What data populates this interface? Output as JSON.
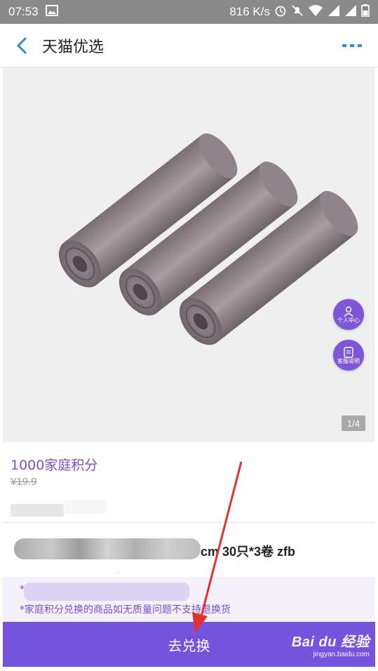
{
  "status_bar": {
    "time": "07:53",
    "net_speed": "816 K/s",
    "icons": [
      "image-icon",
      "alarm-icon",
      "mute-icon",
      "wifi-icon",
      "signal-icon",
      "battery-icon"
    ]
  },
  "nav": {
    "title": "天猫优选",
    "back_icon": "chevron-left-icon",
    "more_icon": "more-icon",
    "accent": "#2a8fd6"
  },
  "floating": {
    "personal_label": "个人中心",
    "service_label": "客服说明",
    "color": "#7d57d6"
  },
  "gallery": {
    "indicator": "1/4"
  },
  "product": {
    "points": "1000家庭积分",
    "original_price": "¥19.9",
    "title_visible_suffix": "cm 30只*3卷 zfb"
  },
  "notice": {
    "line1_prefix": "*",
    "line2": "*家庭积分兑换的商品如无质量问题不支持退换货"
  },
  "cta": {
    "label": "去兑换",
    "color": "#7653dc"
  },
  "watermark": {
    "brand": "Bai du 经验",
    "url": "jingyan.baidu.com"
  }
}
